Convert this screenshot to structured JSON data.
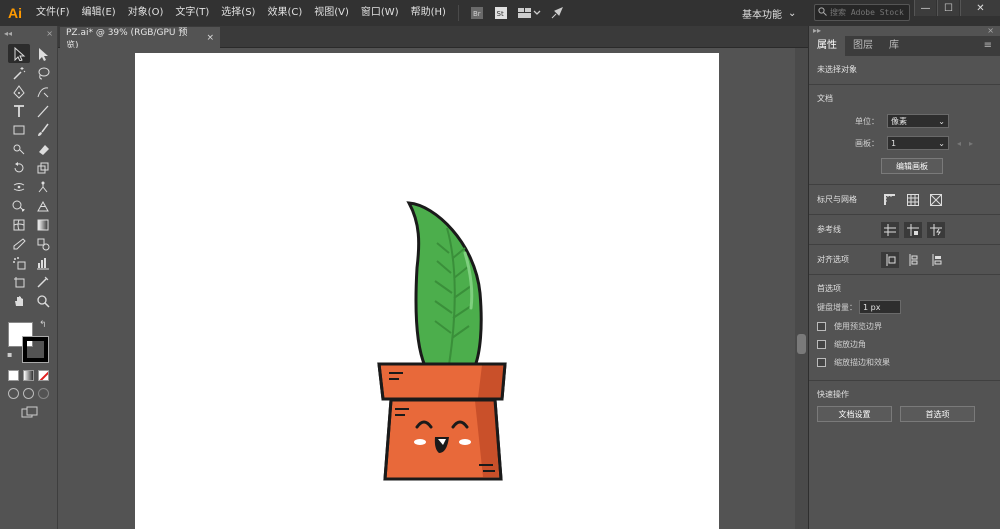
{
  "app": {
    "logo": "Ai"
  },
  "menu": [
    "文件(F)",
    "编辑(E)",
    "对象(O)",
    "文字(T)",
    "选择(S)",
    "效果(C)",
    "视图(V)",
    "窗口(W)",
    "帮助(H)"
  ],
  "menubar_icons": [
    "bridge-icon",
    "stock-icon",
    "arrange-documents-icon",
    "gpu-rocket-icon"
  ],
  "workspace": {
    "label": "基本功能"
  },
  "search": {
    "placeholder": "搜索 Adobe Stock"
  },
  "window_controls": {
    "minimize": "—",
    "maximize": "☐",
    "close": "✕"
  },
  "toolbar": {
    "header_left": "◂◂",
    "header_right": "×",
    "tools": [
      "selection-tool-icon",
      "direct-selection-tool-icon",
      "magic-wand-tool-icon",
      "lasso-tool-icon",
      "pen-tool-icon",
      "curvature-tool-icon",
      "type-tool-icon",
      "line-segment-tool-icon",
      "rectangle-tool-icon",
      "paintbrush-tool-icon",
      "shaper-tool-icon",
      "eraser-tool-icon",
      "rotate-tool-icon",
      "scale-tool-icon",
      "width-tool-icon",
      "puppet-warp-tool-icon",
      "shape-builder-tool-icon",
      "perspective-grid-tool-icon",
      "mesh-tool-icon",
      "gradient-tool-icon",
      "eyedropper-tool-icon",
      "blend-tool-icon",
      "symbol-sprayer-tool-icon",
      "column-graph-tool-icon",
      "artboard-tool-icon",
      "slice-tool-icon",
      "hand-tool-icon",
      "zoom-tool-icon"
    ],
    "fill_color": "#ffffff",
    "stroke_color": "#000000"
  },
  "document_tab": {
    "title": "PZ.ai* @ 39% (RGB/GPU 预览)",
    "close": "×"
  },
  "panel": {
    "top_collapse": "▸▸",
    "top_close": "×",
    "tabs": [
      "属性",
      "图层",
      "库"
    ],
    "menu_icon": "≡",
    "no_selection": "未选择对象",
    "document_title": "文档",
    "units_label": "单位：",
    "units_value": "像素",
    "artboard_label": "画板：",
    "artboard_value": "1",
    "edit_artboards": "编辑画板",
    "rulers_grids": "标尺与网格",
    "guides": "参考线",
    "align_options": "对齐选项",
    "preferences": "首选项",
    "keyboard_increment_label": "键盘增量：",
    "keyboard_increment_value": "1 px",
    "checkbox_preview_bounds": "使用预览边界",
    "checkbox_scale_corners": "缩放边角",
    "checkbox_scale_strokes": "缩放描边和效果",
    "quick_actions": "快速操作",
    "document_setup": "文档设置",
    "preferences_button": "首选项"
  },
  "colors": {
    "leaf_green": "#4cae4c",
    "leaf_dark": "#3a8f3a",
    "pot_orange": "#e8693a",
    "pot_shadow": "#c9502a",
    "outline": "#1a1a1a",
    "blush": "#ffffff"
  }
}
